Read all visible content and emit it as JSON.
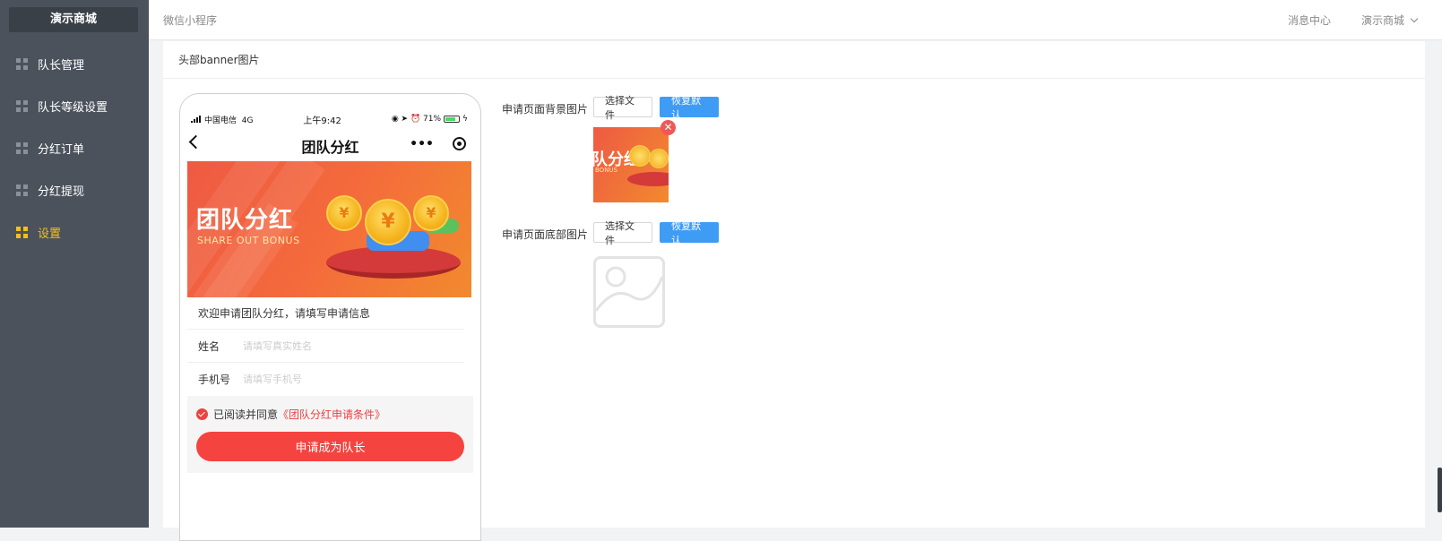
{
  "sidebar": {
    "brand": "演示商城",
    "items": [
      {
        "label": "队长管理",
        "active": false
      },
      {
        "label": "队长等级设置",
        "active": false
      },
      {
        "label": "分红订单",
        "active": false
      },
      {
        "label": "分红提现",
        "active": false
      },
      {
        "label": "设置",
        "active": true
      }
    ]
  },
  "topbar": {
    "breadcrumb": "微信小程序",
    "message_center": "消息中心",
    "store_menu": "演示商城"
  },
  "section": {
    "title": "头部banner图片"
  },
  "phone": {
    "status": {
      "carrier": "中国电信",
      "network": "4G",
      "time": "上午9:42",
      "battery": "71%"
    },
    "nav_title": "团队分红",
    "nav_dots": "•••",
    "banner": {
      "title": "团队分红",
      "subtitle": "SHARE OUT BONUS",
      "coin_symbol": "¥"
    },
    "welcome": "欢迎申请团队分红，请填写申请信息",
    "fields": [
      {
        "label": "姓名",
        "placeholder": "请填写真实姓名"
      },
      {
        "label": "手机号",
        "placeholder": "请填写手机号"
      }
    ],
    "agree_text": "已阅读并同意",
    "agree_link": "《团队分红申请条件》",
    "apply_button": "申请成为队长"
  },
  "uploads": {
    "background": {
      "label": "申请页面背景图片",
      "choose": "选择文件",
      "reset": "恢复默认",
      "delete": "✕"
    },
    "bottom": {
      "label": "申请页面底部图片",
      "choose": "选择文件",
      "reset": "恢复默认"
    }
  },
  "colors": {
    "sidebar": "#4b525c",
    "active": "#f5c018",
    "primary": "#3e9cf5",
    "danger": "#f5433f"
  }
}
